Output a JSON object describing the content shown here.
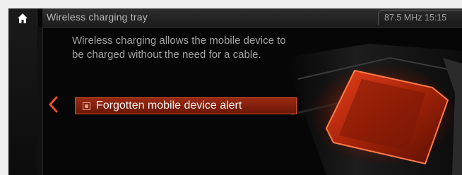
{
  "header": {
    "title": "Wireless charging tray",
    "status": "87.5 MHz 15:15"
  },
  "main": {
    "description": "Wireless charging allows the mobile device to be charged without the need for a cable.",
    "option": {
      "label": "Forgotten mobile device alert",
      "checked": true
    }
  },
  "icons": {
    "home": "home-icon",
    "back": "chevron-left-icon",
    "checkbox": "checkbox-icon"
  },
  "colors": {
    "accent": "#e0502b",
    "highlight_bg": "#7a1c0a",
    "tray_glow": "#ff4a1c"
  }
}
